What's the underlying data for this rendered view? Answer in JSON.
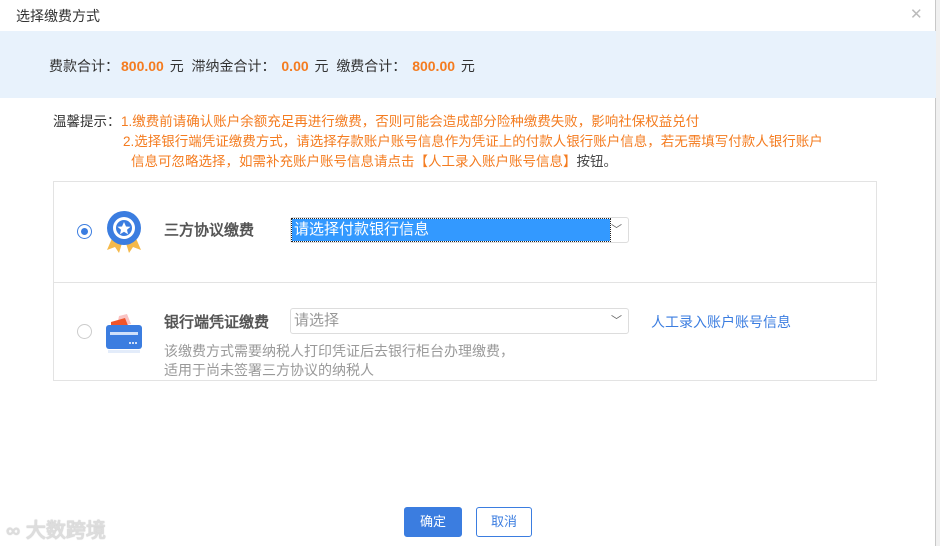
{
  "dialog": {
    "title": "选择缴费方式"
  },
  "summary": {
    "fee_label": "费款合计：",
    "fee": "800.00",
    "unit": "元",
    "late_label": "滞纳金合计：",
    "late": "0.00",
    "total_label": "缴费合计：",
    "total": "800.00"
  },
  "tips": {
    "label": "温馨提示：",
    "line1": "1.缴费前请确认账户余额充足再进行缴费，否则可能会造成部分险种缴费失败，影响社保权益兑付",
    "line2": "2.选择银行端凭证缴费方式，请选择存款账户账号信息作为凭证上的付款人银行账户信息，若无需填写付款人银行账户",
    "line3": "信息可忽略选择，如需补充账户账号信息请点击【人工录入账户账号信息】",
    "line3_tail": "按钮。"
  },
  "options": [
    {
      "label": "三方协议缴费",
      "select_value": "请选择付款银行信息",
      "icon": "badge-icon",
      "selected": true
    },
    {
      "label": "银行端凭证缴费",
      "select_placeholder": "请选择",
      "link": "人工录入账户账号信息",
      "desc1": "该缴费方式需要纳税人打印凭证后去银行柜台办理缴费，",
      "desc2": "适用于尚未签署三方协议的纳税人",
      "icon": "bank-card-icon",
      "selected": false
    }
  ],
  "buttons": {
    "ok": "确定",
    "cancel": "取消"
  },
  "watermark": "大数跨境",
  "colors": {
    "accent": "#3b7de0",
    "amount": "#f47c20",
    "band": "#e8f2fc"
  }
}
